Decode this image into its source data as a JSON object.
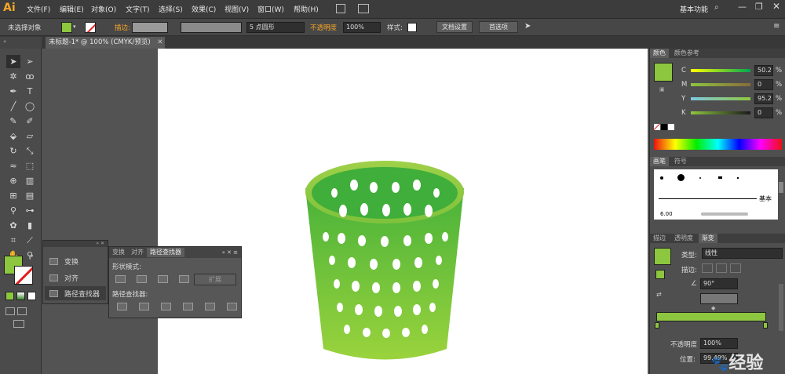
{
  "app": {
    "logo": "Ai"
  },
  "menu": [
    "文件(F)",
    "编辑(E)",
    "对象(O)",
    "文字(T)",
    "选择(S)",
    "效果(C)",
    "视图(V)",
    "窗口(W)",
    "帮助(H)"
  ],
  "workspace": {
    "label": "基本功能",
    "search_icon": "search-icon"
  },
  "control_bar": {
    "selection_label": "未选择对象",
    "stroke_label": "描边:",
    "brush_value": "5 点圆形",
    "opacity_label": "不透明度",
    "opacity_value": "100%",
    "style_label": "样式:",
    "doc_setup": "文档设置",
    "preferences": "首选项"
  },
  "document": {
    "tab_title": "未标题-1* @ 100% (CMYK/预览)"
  },
  "align_panel": {
    "items": [
      "变换",
      "对齐",
      "路径查找器"
    ]
  },
  "pathfinder": {
    "tabs": [
      "变换",
      "对齐",
      "路径查找器"
    ],
    "shape_modes_label": "形状模式:",
    "expand_button": "扩展",
    "pathfinders_label": "路径查找器:"
  },
  "color_panel": {
    "tabs": [
      "颜色",
      "颜色参考"
    ],
    "channels": [
      {
        "name": "C",
        "value": "50.2",
        "unit": "%"
      },
      {
        "name": "M",
        "value": "0",
        "unit": "%"
      },
      {
        "name": "Y",
        "value": "95.2",
        "unit": "%"
      },
      {
        "name": "K",
        "value": "0",
        "unit": "%"
      }
    ]
  },
  "brush_panel": {
    "tabs": [
      "画笔",
      "符号"
    ],
    "basic_label": "基本",
    "size_value": "6.00"
  },
  "gradient_panel": {
    "tabs": [
      "描边",
      "透明度",
      "渐变"
    ],
    "type_label": "类型:",
    "type_value": "线性",
    "stroke_label": "描边:",
    "angle_value": "90°",
    "opacity_label": "不透明度",
    "opacity_value": "100%",
    "location_label": "位置:",
    "location_value": "99.49%"
  },
  "colors": {
    "fill": "#8dc63f",
    "accent": "#f7a627",
    "basket_top": "#5cb83a",
    "basket_bottom": "#8fd03a"
  },
  "watermark": {
    "text": "经验"
  }
}
